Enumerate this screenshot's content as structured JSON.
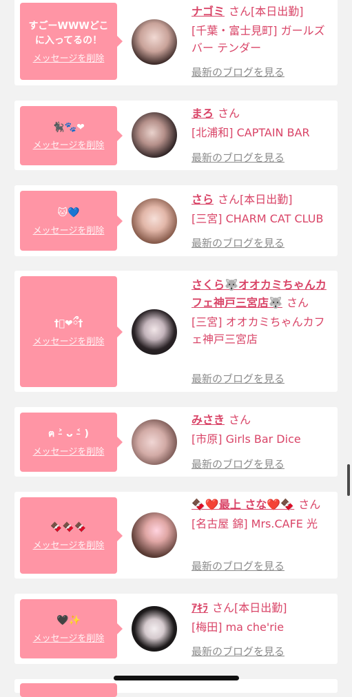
{
  "cards": [
    {
      "message": "すごーWWWどこに入ってるの！",
      "delete_label": "メッセージを削除",
      "name": "ナゴミ",
      "suffix": "さん",
      "status": "[本日出勤]",
      "shop": "[千葉・富士見町] ガールズバー テンダー",
      "blog_label": "最新のブログを見る"
    },
    {
      "message": "🐈‍⬛🐾❤",
      "delete_label": "メッセージを削除",
      "name": "まろ",
      "suffix": "さん",
      "status": "",
      "shop": "[北浦和] CAPTAIN BAR",
      "blog_label": "最新のブログを見る"
    },
    {
      "message": "🐱💙",
      "delete_label": "メッセージを削除",
      "name": "さら",
      "suffix": "さん",
      "status": "[本日出勤]",
      "shop": "[三宮] CHARM CAT CLUB",
      "blog_label": "最新のブログを見る"
    },
    {
      "message": "†ི❤︎ྀ†",
      "delete_label": "メッセージを削除",
      "name": "さくら🐺オオカミちゃんカフェ神戸三宮店🐺",
      "suffix": "さん",
      "status": "",
      "shop": "[三宮] オオカミちゃんカフェ神戸三宮店",
      "blog_label": "最新のブログを見る"
    },
    {
      "message": "ฅ ˃̵ ᴗ ˂̵ )",
      "delete_label": "メッセージを削除",
      "name": "みさき",
      "suffix": "さん",
      "status": "",
      "shop": "[市原] Girls Bar Dice",
      "blog_label": "最新のブログを見る"
    },
    {
      "message": "🍫🍫🍫",
      "delete_label": "メッセージを削除",
      "name": "🍫❤️最上 さな❤️🍫",
      "suffix": "さん",
      "status": "",
      "shop": "[名古屋 錦] Mrs.CAFE 光",
      "blog_label": "最新のブログを見る"
    },
    {
      "message": "🖤✨",
      "delete_label": "メッセージを削除",
      "name": "ｱｷﾗ",
      "suffix": "さん",
      "status": "[本日出勤]",
      "shop": "[梅田] ma che'rie",
      "blog_label": "最新のブログを見る"
    }
  ],
  "colors": {
    "accent": "#d94467",
    "bubble": "#ff95a5",
    "page_bg": "#f2f2f2",
    "blog_link": "#8b8b8b"
  }
}
